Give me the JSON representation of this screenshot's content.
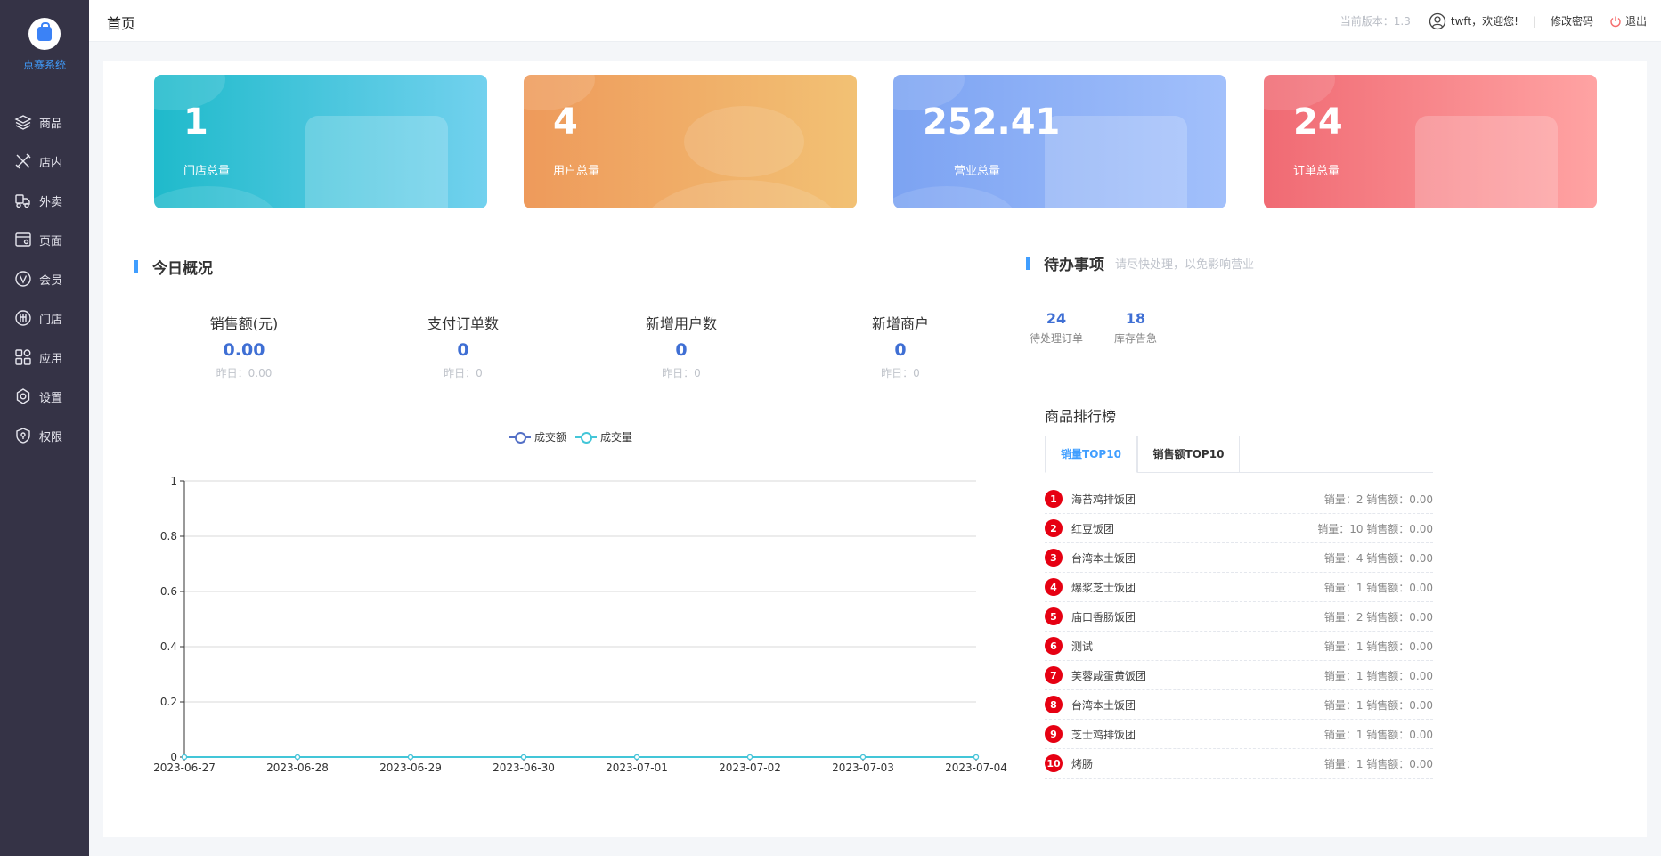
{
  "brand": {
    "name": "点赛系统",
    "icon": "shopping-bag-icon"
  },
  "sidebar": {
    "items": [
      {
        "label": "商品",
        "icon": "layers-icon"
      },
      {
        "label": "店内",
        "icon": "utensils-icon"
      },
      {
        "label": "外卖",
        "icon": "delivery-icon"
      },
      {
        "label": "页面",
        "icon": "browser-icon"
      },
      {
        "label": "会员",
        "icon": "vip-icon"
      },
      {
        "label": "门店",
        "icon": "supply-icon"
      },
      {
        "label": "应用",
        "icon": "apps-icon"
      },
      {
        "label": "设置",
        "icon": "gear-icon"
      },
      {
        "label": "权限",
        "icon": "shield-icon"
      }
    ]
  },
  "header": {
    "title": "首页",
    "version": "当前版本：1.3",
    "user_greeting": "twft，欢迎您!",
    "separator": "|",
    "change_password": "修改密码",
    "logout": "退出"
  },
  "cards": [
    {
      "value": "1",
      "label": "门店总量",
      "icon": "store-icon"
    },
    {
      "value": "4",
      "label": "用户总量",
      "icon": "user-icon"
    },
    {
      "value": "252.41",
      "label": "营业总量",
      "icon": "bag-icon"
    },
    {
      "value": "24",
      "label": "订单总量",
      "icon": "clipboard-icon"
    }
  ],
  "today": {
    "title": "今日概况",
    "stats": [
      {
        "label": "销售额(元)",
        "value": "0.00",
        "yesterday": "昨日：0.00"
      },
      {
        "label": "支付订单数",
        "value": "0",
        "yesterday": "昨日：0"
      },
      {
        "label": "新增用户数",
        "value": "0",
        "yesterday": "昨日：0"
      },
      {
        "label": "新增商户",
        "value": "0",
        "yesterday": "昨日：0"
      }
    ]
  },
  "chart_data": {
    "type": "line",
    "x": [
      "2023-06-27",
      "2023-06-28",
      "2023-06-29",
      "2023-06-30",
      "2023-07-01",
      "2023-07-02",
      "2023-07-03",
      "2023-07-04"
    ],
    "series": [
      {
        "name": "成交额",
        "values": [
          0,
          0,
          0,
          0,
          0,
          0,
          0,
          0
        ],
        "color": "#5470c6"
      },
      {
        "name": "成交量",
        "values": [
          0,
          0,
          0,
          0,
          0,
          0,
          0,
          0
        ],
        "color": "#43c6d8"
      }
    ],
    "ylim": [
      0,
      1
    ],
    "yticks": [
      "0",
      "0.2",
      "0.4",
      "0.6",
      "0.8",
      "1"
    ],
    "grid": true,
    "legend": "top-center"
  },
  "todo": {
    "title": "待办事项",
    "hint": "请尽快处理，以免影响营业",
    "items": [
      {
        "value": "24",
        "label": "待处理订单"
      },
      {
        "value": "18",
        "label": "库存告急"
      }
    ]
  },
  "ranking": {
    "title": "商品排行榜",
    "tabs": [
      "销量TOP10",
      "销售额TOP10"
    ],
    "rows": [
      {
        "rank": "1",
        "name": "海苔鸡排饭团",
        "stats": "销量：2 销售额：0.00"
      },
      {
        "rank": "2",
        "name": "红豆饭团",
        "stats": "销量：10 销售额：0.00"
      },
      {
        "rank": "3",
        "name": "台湾本土饭团",
        "stats": "销量：4 销售额：0.00"
      },
      {
        "rank": "4",
        "name": "爆浆芝士饭团",
        "stats": "销量：1 销售额：0.00"
      },
      {
        "rank": "5",
        "name": "庙口香肠饭团",
        "stats": "销量：2 销售额：0.00"
      },
      {
        "rank": "6",
        "name": "测试",
        "stats": "销量：1 销售额：0.00"
      },
      {
        "rank": "7",
        "name": "芙蓉咸蛋黄饭团",
        "stats": "销量：1 销售额：0.00"
      },
      {
        "rank": "8",
        "name": "台湾本土饭团",
        "stats": "销量：1 销售额：0.00"
      },
      {
        "rank": "9",
        "name": "芝士鸡排饭团",
        "stats": "销量：1 销售额：0.00"
      },
      {
        "rank": "10",
        "name": "烤肠",
        "stats": "销量：1 销售额：0.00"
      }
    ]
  }
}
